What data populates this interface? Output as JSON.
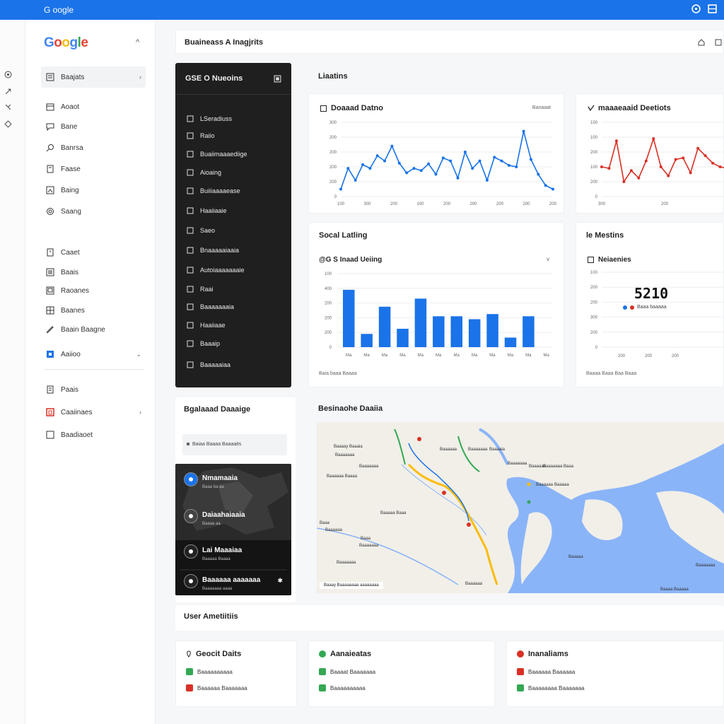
{
  "topbar": {
    "brand": "G oogle"
  },
  "sidebar": {
    "logo": [
      "G",
      "o",
      "o",
      "g",
      "l",
      "e"
    ],
    "logo_colors": [
      "#4285F4",
      "#EA4335",
      "#FBBC05",
      "#4285F4",
      "#34A853",
      "#EA4335"
    ],
    "collapse": "^",
    "items": [
      {
        "label": "Baajats",
        "icon": "dashboard-icon",
        "active": true
      },
      {
        "label": "Aoaot",
        "icon": "calendar-icon"
      },
      {
        "label": "Bane",
        "icon": "chat-icon"
      },
      {
        "label": "Banrsa",
        "icon": "search-icon"
      },
      {
        "label": "Faase",
        "icon": "doc-icon"
      },
      {
        "label": "Baing",
        "icon": "image-icon"
      },
      {
        "label": "Saang",
        "icon": "settings-icon"
      },
      {
        "label": "Caaet",
        "icon": "file-icon"
      },
      {
        "label": "Baais",
        "icon": "list-icon"
      },
      {
        "label": "Raoanes",
        "icon": "table-icon"
      },
      {
        "label": "Baanes",
        "icon": "grid-icon"
      },
      {
        "label": "Baain Baagne",
        "icon": "pen-icon"
      },
      {
        "label": "Aaiioo",
        "icon": "blue-square-icon"
      },
      {
        "label": "Paais",
        "icon": "report-icon"
      },
      {
        "label": "Caaiinaes",
        "icon": "red-box-icon"
      },
      {
        "label": "Baadiaoet",
        "icon": "empty-box-icon"
      }
    ]
  },
  "header": {
    "title": "Buaineass A Inagjrits"
  },
  "dark_panel": {
    "title": "GSE O Nueoins",
    "items": [
      "LSeradiuss",
      "Raiio",
      "Buaiimaaaediige",
      "Aioaing",
      "Buiiiaaaaease",
      "Haaiiaaie",
      "Saeo",
      "Bnaaaaaiaaia",
      "Autoiaaaaaaaie",
      "Raai",
      "Baaaaaaaia",
      "Haaiiaae",
      "Baaaip",
      "Baaaaaiaa"
    ]
  },
  "linechart_section": {
    "title": "Liaatins"
  },
  "chart_data": [
    {
      "type": "line",
      "title": "Doaaad Datno",
      "badge": "Banaaat",
      "color": "#1a73e8",
      "yticks": [
        "300",
        "200",
        "200",
        "200",
        "200",
        "0"
      ],
      "xticks": [
        "100",
        "300",
        "200",
        "100",
        "200",
        "200",
        "200",
        "200",
        "200"
      ],
      "values": [
        10,
        38,
        22,
        43,
        38,
        55,
        48,
        68,
        45,
        32,
        38,
        35,
        44,
        30,
        52,
        48,
        25,
        60,
        38,
        48,
        22,
        53,
        48,
        42,
        40,
        88,
        50,
        30,
        15,
        10
      ]
    },
    {
      "type": "line",
      "title": "maaaeaaid Deetiots",
      "color": "#d93025",
      "yticks": [
        "100",
        "100",
        "200",
        "100",
        "200",
        "0"
      ],
      "xticks": [
        "300",
        "200",
        "200"
      ],
      "values": [
        40,
        38,
        75,
        20,
        35,
        25,
        48,
        78,
        40,
        28,
        50,
        52,
        32,
        65,
        55,
        45,
        40,
        38
      ]
    },
    {
      "type": "bar",
      "title": "@G S Inaad Ueiing",
      "color": "#1a73e8",
      "yticks": [
        "100",
        "400",
        "200",
        "200",
        "200",
        "0"
      ],
      "categories": [
        "Ma",
        "Ma",
        "Ma",
        "Ma",
        "Ma",
        "Ma",
        "Ma",
        "Ma",
        "Ma",
        "Ma",
        "Ma",
        "Ma"
      ],
      "values": [
        78,
        18,
        55,
        25,
        66,
        42,
        42,
        38,
        45,
        13,
        42,
        0
      ],
      "footer": "Baia baaa Baaaa"
    }
  ],
  "social_section": {
    "title": "Socal Latling",
    "dropdown": "v"
  },
  "metrics_section": {
    "title": "le Mestins",
    "subtitle": "Neiaenies",
    "big_value": "5210",
    "legend": "Baaa baaaaa",
    "yticks": [
      "100",
      "200",
      "200",
      "300",
      "200",
      "0"
    ],
    "xticks": [
      "200",
      "200",
      "200"
    ],
    "footer": "Baaaa Baaa Baa Baaa"
  },
  "bottom_left": {
    "title": "Bgalaaad Daaaige",
    "search": "Baiaa Baaaa Baaaaits",
    "items": [
      {
        "t1": "Nmamaaia",
        "t2": "Baaa ba aa",
        "color": "#1a73e8"
      },
      {
        "t1": "Daiaahaiaaia",
        "t2": "Baaaa aa",
        "color": "#444"
      },
      {
        "t1": "Lai Maaaiaa",
        "t2": "Baaaaa Baaaa",
        "color": "#222"
      },
      {
        "t1": "Baaaaaa aaaaaaa",
        "t2": "Baaaaaaa aaaa",
        "color": "#222"
      }
    ]
  },
  "map_section": {
    "title": "Besinaohe Daaiia",
    "legend": "Baaay  Baaaaaaaa aaaaaaaa",
    "labels": [
      "Baaaay Baaaia",
      "Baaaaaaa",
      "Baaaaaa Baaaa",
      "Baaaaaaa",
      "Baaaaaa",
      "Baaaaaaa",
      "Baaaaia",
      "Baaaaaaa",
      "Baaaaaa",
      "Baaaaaaa Baaa",
      "Baaaaaa",
      "Baaaaa",
      "Baaaaa Baaa",
      "Baaa",
      "Baaaaaa",
      "Baaa",
      "Baaaaaaa",
      "Baaaaaaa",
      "Baaaaaa",
      "Baaaaa",
      "Baaaaaaa",
      "Baaaa Baaaaa"
    ]
  },
  "user_analytics": {
    "title": "User Ametiitiis",
    "cards": [
      {
        "title": "Geocit Daits",
        "icon": "pin-icon",
        "items": [
          {
            "label": "Baaaaaaaaaa",
            "color": "#34a853"
          },
          {
            "label": "Baaaaaa Baaaaaaa",
            "color": "#d93025"
          }
        ]
      },
      {
        "title": "Aanaieatas",
        "icon": "green-dot-icon",
        "items": [
          {
            "label": "Baaaat Baaaaaaa",
            "color": "#34a853"
          },
          {
            "label": "Baaaaaaaaaa",
            "color": "#34a853"
          }
        ]
      },
      {
        "title": "Inanaliams",
        "icon": "red-dot-icon",
        "items": [
          {
            "label": "Baaaaaa Baaaaaa",
            "color": "#d93025"
          },
          {
            "label": "Baaaaaaaa Baaaaaaa",
            "color": "#34a853"
          }
        ]
      }
    ]
  },
  "colors": {
    "accent": "#1a73e8",
    "red": "#d93025",
    "green": "#34a853",
    "yellow": "#fbbc05",
    "dark": "#1f1f1f"
  }
}
